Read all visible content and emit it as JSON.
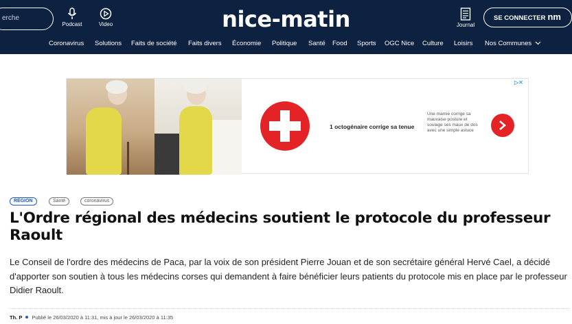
{
  "header": {
    "search_placeholder": "erche",
    "podcast_label": "Podcast",
    "video_label": "Video",
    "brand": "nice-matin",
    "journal_label": "Journal",
    "connect_label": "SE CONNECTER",
    "connect_logo": "nm"
  },
  "nav": {
    "items": [
      "Coronavirus",
      "Solutions",
      "Faits de société",
      "Faits divers",
      "Économie",
      "Politique",
      "Santé",
      "Food",
      "Sports",
      "OGC Nice",
      "Culture",
      "Loisirs",
      "Nos Communes"
    ]
  },
  "ad": {
    "headline": "1 octogénaire corrige sa tenue",
    "description": "Une mamie corrige sa mauvaise posture et soulage ses maux de dos avec une simple astuce",
    "adchoices": "▷✕"
  },
  "article": {
    "tags": [
      "RÉGION",
      "Santé",
      "coronavirus"
    ],
    "title": "L'Ordre régional des médecins soutient le protocole du professeur Raoult",
    "lead": "Le Conseil de l'ordre des médecins de Paca, par la voix de son président Pierre Jouan et de son secrétaire général Hervé Cael, a décidé d'apporter son soutien à tous les médecins corses qui demandent à faire bénéficier leurs patients du protocole mis en place par le professeur Didier Raoult.",
    "author": "Th. P",
    "published": "Publié le 26/03/2020 à 11:31, mis à jour le 26/03/2020 à 11:35"
  },
  "colors": {
    "header_bg": "#0d2240",
    "accent_blue": "#1a57c8",
    "ad_red": "#e32326"
  }
}
